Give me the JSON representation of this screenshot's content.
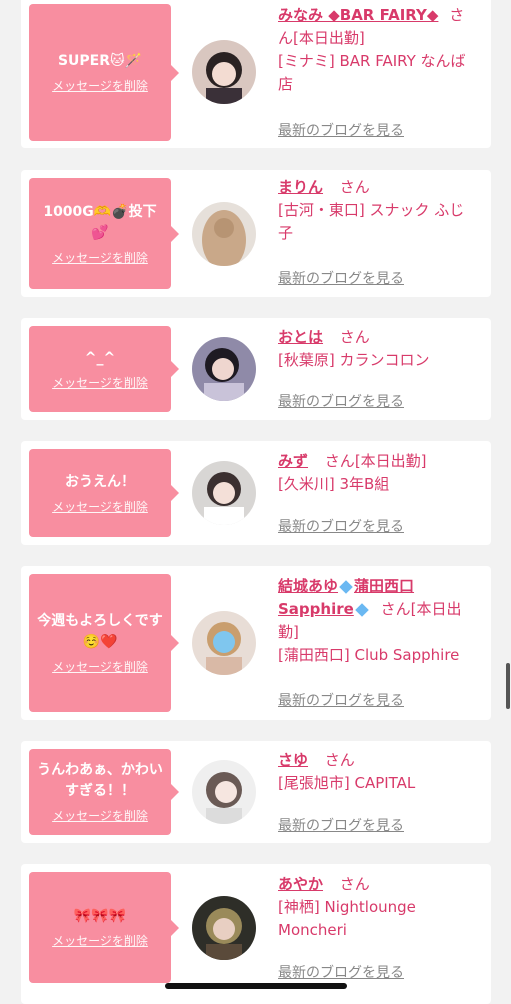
{
  "delete_label": "メッセージを削除",
  "blog_label": "最新のブログを見る",
  "honorific": "さん",
  "colors": {
    "bubble": "#f88ea0",
    "accent": "#d83a6a",
    "link_gray": "#888888",
    "background": "#f2f2f2"
  },
  "items": [
    {
      "message": "SUPER🐱🪄",
      "name": "みなみ ◆BAR FAIRY◆",
      "status": "[本日出勤]",
      "shop": "[ミナミ] BAR FAIRY なんば店",
      "avatar": "avatar-photo"
    },
    {
      "message": "1000G🫶💣投下💕",
      "name": "まりん",
      "status": "",
      "shop": "[古河・東口] スナック ふじ子",
      "avatar": "avatar-photo"
    },
    {
      "message": "^_^",
      "name": "おとは",
      "status": "",
      "shop": "[秋葉原] カランコロン",
      "avatar": "avatar-photo"
    },
    {
      "message": "おうえん！",
      "name": "みず",
      "status": "[本日出勤]",
      "shop": "[久米川] 3年B組",
      "avatar": "avatar-photo"
    },
    {
      "message": "今週もよろしくです☺️❤️",
      "name_part1": "結城あゆ",
      "name_part2": "蒲田西口 Sapphire",
      "status": "[本日出勤]",
      "shop": "[蒲田西口] Club Sapphire",
      "avatar": "avatar-photo"
    },
    {
      "message": "うんわあぁ、かわいすぎる！！",
      "name": "さゆ",
      "status": "",
      "shop": "[尾張旭市] CAPITAL",
      "avatar": "avatar-photo"
    },
    {
      "message": "🎀🎀🎀",
      "name": "あやか",
      "status": "",
      "shop": "[神栖] Nightlounge Moncheri",
      "avatar": "avatar-photo"
    }
  ]
}
